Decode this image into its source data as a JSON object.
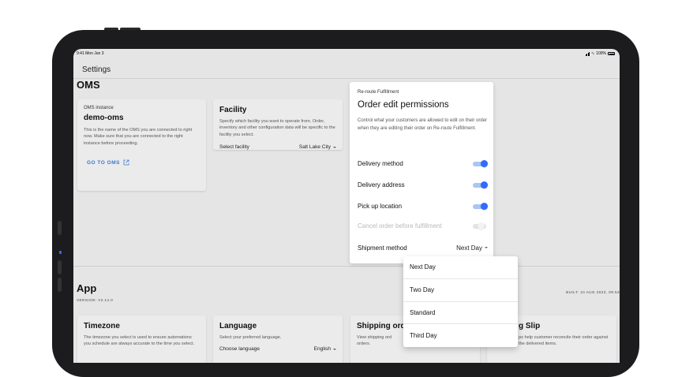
{
  "status": {
    "time": "9:41",
    "date": "Mon Jun 3",
    "battery": "100%"
  },
  "toolbar": {
    "title": "Settings"
  },
  "oms": {
    "section_title": "OMS",
    "instance_card": {
      "kicker": "OMS instance",
      "title": "demo-oms",
      "desc": "This is the name of the OMS you are connected to right now. Make sure that you are connected to the right instance before proceeding.",
      "link": "GO TO OMS"
    },
    "facility_card": {
      "title": "Facility",
      "desc": "Specify which facility you want to operate from. Order, inventory and other configuration data will be specific to the facility you select.",
      "select_label": "Select facility",
      "select_value": "Salt Lake City"
    }
  },
  "reroute": {
    "kicker": "Re-route Fulfillment",
    "title": "Order edit permissions",
    "desc": "Control what your customers are allowed to edit on their order when they are editing their order on Re-route Fulfillment.",
    "toggles": [
      {
        "label": "Delivery method",
        "on": true,
        "disabled": false
      },
      {
        "label": "Delivery address",
        "on": true,
        "disabled": false
      },
      {
        "label": "Pick up location",
        "on": true,
        "disabled": false
      },
      {
        "label": "Cancel order before fulfillment",
        "on": false,
        "disabled": true
      }
    ],
    "shipment_label": "Shipment method",
    "shipment_value": "Next Day",
    "options": [
      "Next Day",
      "Two Day",
      "Standard",
      "Third Day"
    ]
  },
  "app": {
    "section_title": "App",
    "version": "VERSION: V2.14.0",
    "built": "BUILT: 10 AUG 2023, 09:53",
    "timezone_card": {
      "title": "Timezone",
      "desc": "The timezone you select is used to ensure automations you schedule are always accurate to the time you select."
    },
    "language_card": {
      "title": "Language",
      "desc": "Select your preferred language.",
      "select_label": "Choose language",
      "select_value": "English"
    },
    "shipping_card": {
      "title": "Shipping ord",
      "desc": "View shipping ord orders."
    },
    "packing_card": {
      "title": "g Slip",
      "desc": "ps help customer reconcile their order against the delivered items."
    }
  },
  "colors": {
    "accent": "#2f6bff",
    "link": "#3a7bd5",
    "background": "#e5e5e5"
  }
}
